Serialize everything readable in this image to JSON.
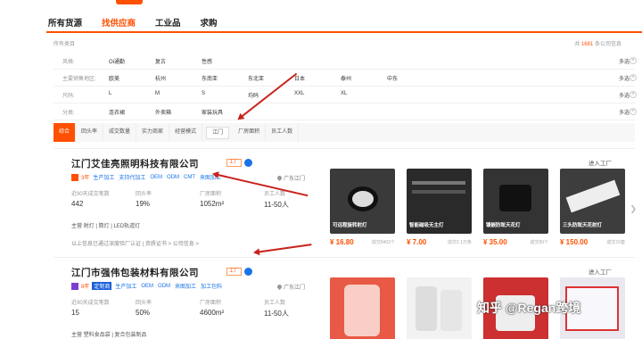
{
  "nav": {
    "tabs": [
      "所有货源",
      "找供应商",
      "工业品",
      "求购"
    ],
    "active_index": 1
  },
  "breadcrumb": "所有类目",
  "result": {
    "prefix": "共",
    "count": "1681",
    "suffix": "条公司信息"
  },
  "filters": [
    {
      "label": "风格:",
      "options": [
        "Oi通勤",
        "复古",
        "性感"
      ],
      "more": "多选"
    },
    {
      "label": "主要销售地区:",
      "options": [
        "欧美",
        "杭州",
        "东南亚",
        "东北亚",
        "日本",
        "泰州",
        "中东"
      ],
      "more": "多选"
    },
    {
      "label": "尺码:",
      "options": [
        "L",
        "M",
        "S",
        "均码",
        "XXL",
        "XL"
      ],
      "more": "多选"
    },
    {
      "label": "分类:",
      "options": [
        "连衣裙",
        "外卖箱",
        "家装玩具"
      ],
      "more": "多选"
    }
  ],
  "sort": {
    "items": [
      "综合",
      "回头率",
      "成交数量",
      "实力商家",
      "经营模式",
      "江门",
      "厂房面积",
      "员工人数"
    ],
    "active_index": 0
  },
  "suppliers": [
    {
      "name": "江门艾佳亮照明科技有限公司",
      "tag": "工厂",
      "badges": [
        "3年",
        "生产加工",
        "支持代加工",
        "OEM",
        "ODM",
        "CMT",
        "来图加工"
      ],
      "location": "广东江门",
      "enter": "进入工厂",
      "stats": [
        {
          "label": "近90天成交笔数",
          "value": "442"
        },
        {
          "label": "回头率",
          "value": "19%"
        },
        {
          "label": "厂房面积",
          "value": "1052m²"
        },
        {
          "label": "员工人数",
          "value": "11-50人"
        }
      ],
      "main": "主营 射灯 | 筒灯 | LED轨道灯",
      "cert": "以上信息已通过深度验厂认证 | 资质证书 > 公司信息 >",
      "products": [
        {
          "caption": "可远程旋转射灯",
          "price": "¥ 16.80",
          "sold": "成交8402个",
          "color": "#3a3a3a"
        },
        {
          "caption": "智能磁吸无主灯",
          "price": "¥ 7.00",
          "sold": "成交2.1万条",
          "color": "#2a2a2a"
        },
        {
          "caption": "镶嵌防眩天花灯",
          "price": "¥ 35.00",
          "sold": "成交89个",
          "color": "#333"
        },
        {
          "caption": "三头防眩天花射灯",
          "price": "¥ 150.00",
          "sold": "成交15套",
          "color": "#3d3d3d"
        }
      ]
    },
    {
      "name": "江门市强伟包装材料有限公司",
      "tag": "工厂",
      "badges": [
        "8年",
        "定制商",
        "生产加工",
        "OEM",
        "ODM",
        "来图加工",
        "加工包料"
      ],
      "location": "广东江门",
      "enter": "进入工厂",
      "stats": [
        {
          "label": "近90天成交笔数",
          "value": "15"
        },
        {
          "label": "回头率",
          "value": "50%"
        },
        {
          "label": "厂房面积",
          "value": "4600m²"
        },
        {
          "label": "员工人数",
          "value": "11-50人"
        }
      ],
      "main": "主营 塑料食品袋 | 复合包装制品",
      "products": [
        {
          "caption": "",
          "price": "",
          "sold": "",
          "color": "#e85a45"
        },
        {
          "caption": "",
          "price": "",
          "sold": "",
          "color": "#f2f2f2"
        },
        {
          "caption": "",
          "price": "",
          "sold": "",
          "color": "#cc3030"
        },
        {
          "caption": "",
          "price": "",
          "sold": "",
          "color": "#e8e8ee"
        }
      ]
    }
  ],
  "watermark": "知乎 @Regan跨境",
  "accent": "#ff5000"
}
